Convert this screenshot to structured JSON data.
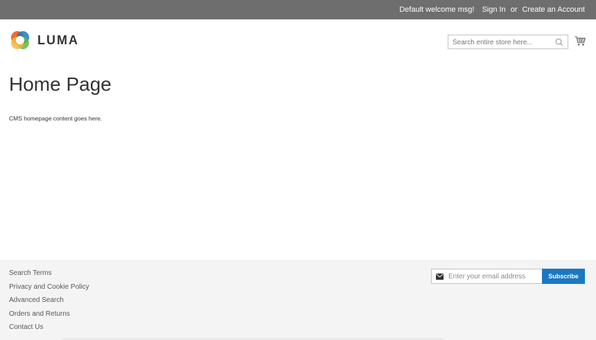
{
  "panel": {
    "welcome": "Default welcome msg!",
    "sign_in": "Sign In",
    "or": "or",
    "create_account": "Create an Account"
  },
  "header": {
    "logo_text": "LUMA",
    "search_placeholder": "Search entire store here...",
    "icons": {
      "search": "search-icon",
      "cart": "cart-icon"
    }
  },
  "main": {
    "title": "Home Page",
    "content": "CMS homepage content goes here."
  },
  "footer": {
    "links": [
      "Search Terms",
      "Privacy and Cookie Policy",
      "Advanced Search",
      "Orders and Returns",
      "Contact Us"
    ],
    "newsletter_placeholder": "Enter your email address",
    "subscribe_label": "Subscribe",
    "icons": {
      "mail": "mail-icon"
    }
  },
  "colors": {
    "panel_bg": "#6e6e6e",
    "footer_bg": "#f4f4f4",
    "accent": "#1979c3",
    "logo_orange": "#f26322",
    "logo_blue": "#1979c3",
    "logo_green": "#6bb345",
    "logo_yellow": "#f6b83f"
  }
}
